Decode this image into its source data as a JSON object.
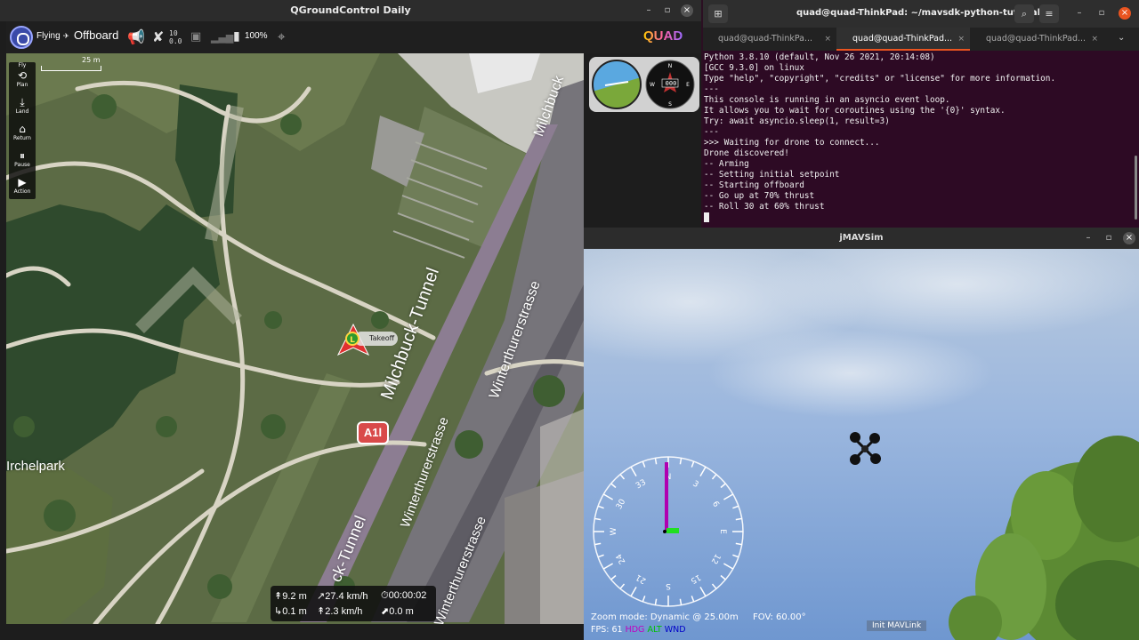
{
  "qgc": {
    "window_title": "QGroundControl Daily",
    "toolbar": {
      "flight_state": "Flying",
      "flight_mode": "Offboard",
      "gps_count": "10",
      "gps_hdop": "0.0",
      "battery": "100%",
      "brand": "QUAD"
    },
    "tools": [
      {
        "label": "Fly",
        "icon": "fly-icon"
      },
      {
        "label": "Plan",
        "icon": "plan-icon"
      },
      {
        "label": "Land",
        "icon": "land-icon"
      },
      {
        "label": "Return",
        "icon": "return-icon"
      },
      {
        "label": "Pause",
        "icon": "pause-icon"
      },
      {
        "label": "Action",
        "icon": "action-icon"
      }
    ],
    "map": {
      "scale_label": "25 m",
      "takeoff_marker": "L",
      "takeoff_label": "Takeoff",
      "park_label": "Irchelpark",
      "tunnel_label_1": "Milchbuck-Tunnel",
      "tunnel_label_2": "ck-Tunnel",
      "street_label_1": "Winterthurerstrasse",
      "street_label_2": "Winterthurerstrasse",
      "street_label_3": "Winterthurerstrasse",
      "street_label_4": "Milchbuck",
      "road_sign": "A1l"
    },
    "attitude_readout": "000",
    "telemetry": {
      "altitude": "9.2 m",
      "horizontal_speed": "27.4 km/h",
      "flight_time": "00:00:02",
      "vertical_distance": "0.1 m",
      "vertical_speed": "2.3 km/h",
      "distance_home": "0.0 m"
    }
  },
  "terminal": {
    "window_title": "quad@quad-ThinkPad: ~/mavsdk-python-tutorials",
    "tabs": [
      {
        "label": "quad@quad-ThinkPa..."
      },
      {
        "label": "quad@quad-ThinkPad..."
      },
      {
        "label": "quad@quad-ThinkPad..."
      }
    ],
    "lines": [
      "Python 3.8.10 (default, Nov 26 2021, 20:14:08)",
      "[GCC 9.3.0] on linux",
      "Type \"help\", \"copyright\", \"credits\" or \"license\" for more information.",
      "---",
      "This console is running in an asyncio event loop.",
      "It allows you to wait for coroutines using the '{0}' syntax.",
      "Try: await asyncio.sleep(1, result=3)",
      "---",
      ">>> Waiting for drone to connect...",
      "Drone discovered!",
      "-- Arming",
      "-- Setting initial setpoint",
      "-- Starting offboard",
      "-- Go up at 70% thrust",
      "-- Roll 30 at 60% thrust"
    ]
  },
  "jmavsim": {
    "window_title": "jMAVSim",
    "zoom_text": "Zoom mode: Dynamic @ 25.00m",
    "fov_text": "FOV: 60.00°",
    "fps_label": "FPS:",
    "fps_value": "61",
    "hdg_label": "HDG",
    "alt_label": "ALT",
    "wnd_label": "WND",
    "compass_labels": [
      "N",
      "3",
      "6",
      "E",
      "12",
      "15",
      "S",
      "21",
      "24",
      "W",
      "30",
      "33"
    ],
    "init_text": "Init MAVLink",
    "colors": {
      "hdg": "#c000c0",
      "alt": "#00c000",
      "wnd": "#0000c8"
    }
  }
}
